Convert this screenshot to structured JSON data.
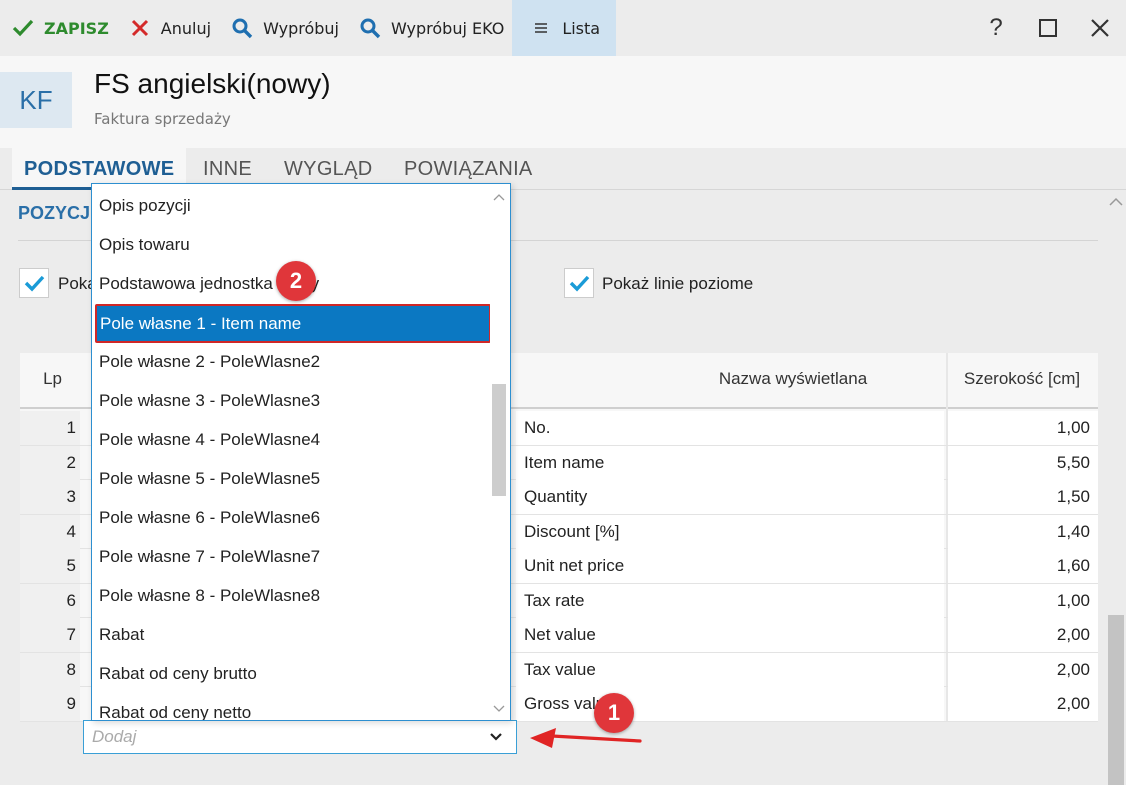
{
  "toolbar": {
    "save_label": "ZAPISZ",
    "cancel_label": "Anuluj",
    "try_label": "Wypróbuj",
    "try_eko_label": "Wypróbuj EKO",
    "list_label": "Lista",
    "help_label": "?"
  },
  "header": {
    "badge": "KF",
    "title": "FS angielski(nowy)",
    "subtitle": "Faktura sprzedaży"
  },
  "tabs": [
    {
      "label": "PODSTAWOWE",
      "active": true
    },
    {
      "label": "INNE"
    },
    {
      "label": "WYGLĄD"
    },
    {
      "label": "POWIĄZANIA"
    }
  ],
  "section": {
    "title": "POZYCJ",
    "checkbox_left_label": "Poka",
    "checkbox_right_label": "Pokaż linie poziome"
  },
  "table": {
    "headers": {
      "lp": "Lp",
      "nazwa": "Nazwa wyświetlana",
      "szer": "Szerokość [cm]"
    },
    "rows": [
      {
        "lp": "1",
        "nazwa": "No.",
        "szer": "1,00"
      },
      {
        "lp": "2",
        "nazwa": "Item name",
        "szer": "5,50"
      },
      {
        "lp": "3",
        "nazwa": "Quantity",
        "szer": "1,50"
      },
      {
        "lp": "4",
        "nazwa": "Discount [%]",
        "szer": "1,40"
      },
      {
        "lp": "5",
        "nazwa": "Unit net price",
        "szer": "1,60"
      },
      {
        "lp": "6",
        "nazwa": "Tax rate",
        "szer": "1,00"
      },
      {
        "lp": "7",
        "nazwa": "Net value",
        "szer": "2,00"
      },
      {
        "lp": "8",
        "nazwa": "Tax value",
        "szer": "2,00"
      },
      {
        "lp": "9",
        "nazwa": "Gross value",
        "szer": "2,00"
      }
    ]
  },
  "add_select": {
    "placeholder": "Dodaj"
  },
  "dropdown": {
    "items": [
      "Opis pozycji",
      "Opis towaru",
      "Podstawowa jednostka miary",
      "Pole własne 1 - Item name",
      "Pole własne 2 - PoleWlasne2",
      "Pole własne 3 - PoleWlasne3",
      "Pole własne 4 - PoleWlasne4",
      "Pole własne 5 - PoleWlasne5",
      "Pole własne 6 - PoleWlasne6",
      "Pole własne 7 - PoleWlasne7",
      "Pole własne 8 - PoleWlasne8",
      "Rabat",
      "Rabat od ceny brutto",
      "Rabat od ceny netto"
    ],
    "selected_index": 3
  },
  "annotations": {
    "badge_1": "1",
    "badge_2": "2"
  },
  "colors": {
    "accent": "#1f5f94",
    "selection": "#0b78c2",
    "annotation": "#e0363a",
    "save": "#2e8b2e"
  }
}
